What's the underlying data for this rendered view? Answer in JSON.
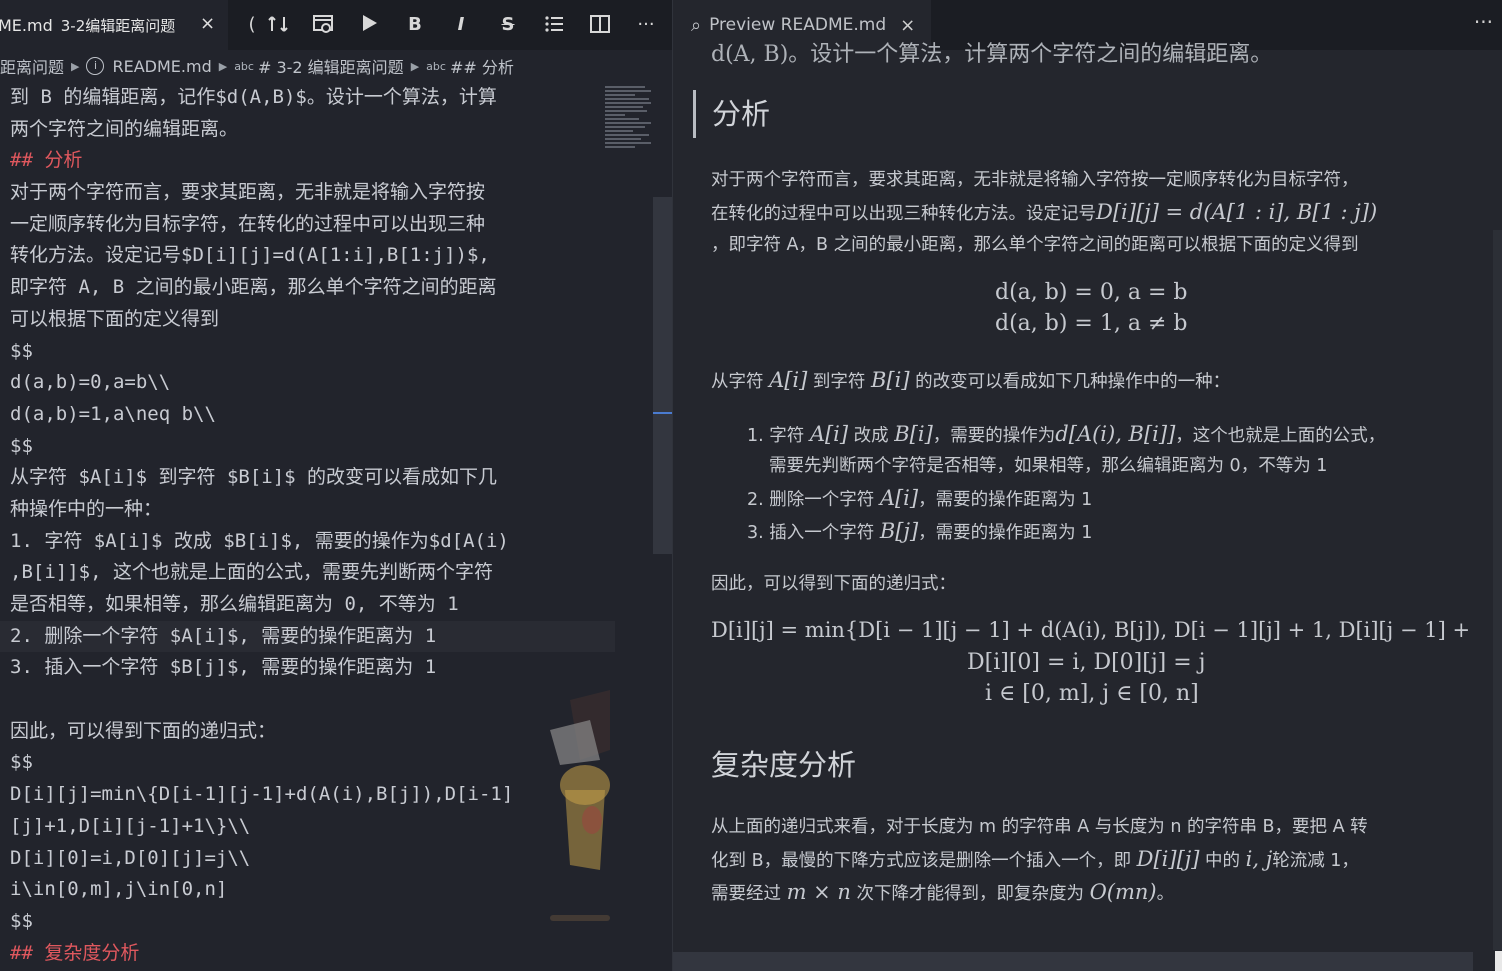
{
  "left_tab": {
    "filename": "ME.md",
    "title": "3-2编辑距离问题",
    "close": "×"
  },
  "toolbar": {
    "bold": "B",
    "italic": "I",
    "strike": "S",
    "more": "···"
  },
  "breadcrumb": {
    "part1": "距离问题",
    "file": "README.md",
    "abc": "abc",
    "h1": "# 3-2 编辑距离问题",
    "h2": "## 分析"
  },
  "editor_lines": [
    "到 B 的编辑距离，记作$d(A,B)$。设计一个算法，计算",
    "两个字符之间的编辑距离。",
    "## 分析",
    "对于两个字符而言，要求其距离，无非就是将输入字符按",
    "一定顺序转化为目标字符，在转化的过程中可以出现三种",
    "转化方法。设定记号$D[i][j]=d(A[1:i],B[1:j])$,",
    "即字符 A, B 之间的最小距离，那么单个字符之间的距离",
    "可以根据下面的定义得到",
    "$$",
    "d(a,b)=0,a=b\\\\",
    "d(a,b)=1,a\\neq b\\\\",
    "$$",
    "从字符 $A[i]$ 到字符 $B[i]$ 的改变可以看成如下几",
    "种操作中的一种：",
    "1. 字符 $A[i]$ 改成 $B[i]$, 需要的操作为$d[A(i)",
    ",B[i]]$, 这个也就是上面的公式，需要先判断两个字符",
    "是否相等，如果相等，那么编辑距离为 0, 不等为 1",
    "2. 删除一个字符 $A[i]$, 需要的操作距离为 1",
    "3. 插入一个字符 $B[j]$, 需要的操作距离为 1",
    "",
    "因此，可以得到下面的递归式：",
    "$$",
    "D[i][j]=min\\{D[i-1][j-1]+d(A(i),B[j]),D[i-1]",
    "[j]+1,D[i][j-1]+1\\}\\\\",
    "D[i][0]=i,D[0][j]=j\\\\",
    "i\\in[0,m],j\\in[0,n]",
    "$$",
    "## 复杂度分析"
  ],
  "right_tab": {
    "title": "Preview README.md",
    "close": "×",
    "more": "···"
  },
  "preview": {
    "clipped": "d(A, B)。设计一个算法，计算两个字符之间的编辑距离。",
    "h_analysis": "分析",
    "para1_l1": "对于两个字符而言，要求其距离，无非就是将输入字符按一定顺序转化为目标字符，",
    "para1_l2a": "在转化的过程中可以出现三种转化方法。设定记号",
    "para1_l2m": "D[i][j] = d(A[1 : i], B[1 : j])",
    "para1_l3": "，即字符 A，B 之间的最小距离，那么单个字符之间的距离可以根据下面的定义得到",
    "eq1": "d(a, b) = 0, a = b",
    "eq2": "d(a, b) = 1, a ≠ b",
    "para2_a": "从字符 ",
    "para2_m1": "A[i]",
    "para2_b": " 到字符 ",
    "para2_m2": "B[i]",
    "para2_c": " 的改变可以看成如下几种操作中的一种：",
    "li1_a": "1. 字符 ",
    "li1_m1": "A[i]",
    "li1_b": " 改成 ",
    "li1_m2": "B[i]",
    "li1_c": "，需要的操作为",
    "li1_m3": "d[A(i), B[i]]",
    "li1_d": "，这个也就是上面的公式，",
    "li1_l2": "需要先判断两个字符是否相等，如果相等，那么编辑距离为 0，不等为 1",
    "li2_a": "2. 删除一个字符 ",
    "li2_m": "A[i]",
    "li2_b": "，需要的操作距离为 1",
    "li3_a": "3. 插入一个字符 ",
    "li3_m": "B[j]",
    "li3_b": "，需要的操作距离为 1",
    "para3": "因此，可以得到下面的递归式：",
    "eq3": "D[i][j] = min{D[i − 1][j − 1] + d(A(i), B[j]), D[i − 1][j] + 1, D[i][j − 1] +",
    "eq4": "D[i][0] = i, D[0][j] = j",
    "eq5": "i ∈ [0, m], j ∈ [0, n]",
    "h_complex": "复杂度分析",
    "para4_l1": "从上面的递归式来看，对于长度为 m 的字符串 A 与长度为 n 的字符串 B，要把 A 转",
    "para4_l2a": "化到 B，最慢的下降方式应该是删除一个插入一个，即 ",
    "para4_l2m": "D[i][j]",
    "para4_l2b": " 中的 ",
    "para4_l2m2": "i, j",
    "para4_l2c": "轮流减 1，",
    "para4_l3a": "需要经过 ",
    "para4_l3m": "m × n",
    "para4_l3b": " 次下降才能得到，即复杂度为 ",
    "para4_l3m2": "O(mn)",
    "para4_l3c": "。"
  }
}
